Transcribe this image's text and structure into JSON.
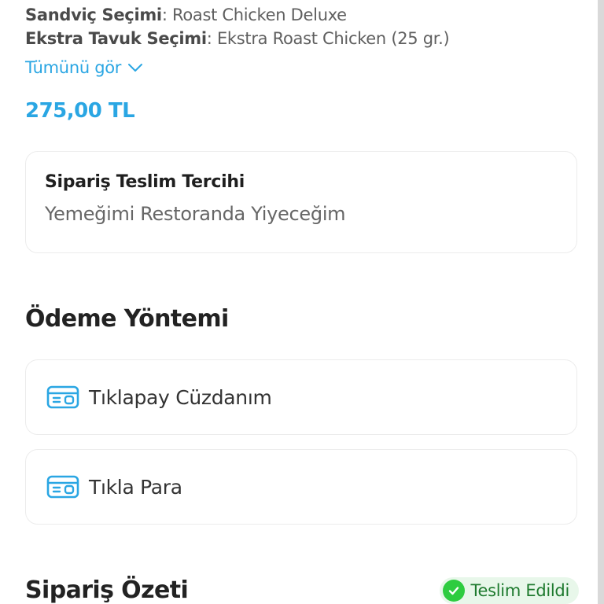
{
  "options": [
    {
      "key": "Sandviç Seçimi",
      "value": ": Roast Chicken Deluxe"
    },
    {
      "key": "Ekstra Tavuk Seçimi",
      "value": ": Ekstra Roast Chicken (25 gr.)"
    }
  ],
  "see_all": "Tümünü gör",
  "price": "275,00 TL",
  "delivery": {
    "title": "Sipariş Teslim Tercihi",
    "value": "Yemeğimi Restoranda Yiyeceğim"
  },
  "payment": {
    "title": "Ödeme Yöntemi",
    "methods": [
      {
        "label": "Tıklapay Cüzdanım",
        "icon": "wallet-card-icon"
      },
      {
        "label": "Tıkla Para",
        "icon": "wallet-card-icon"
      }
    ]
  },
  "summary": {
    "title": "Sipariş Özeti",
    "status": "Teslim Edildi",
    "status_color": "#2ecc40"
  },
  "colors": {
    "accent": "#2aa6e3",
    "success": "#2ecc40"
  }
}
